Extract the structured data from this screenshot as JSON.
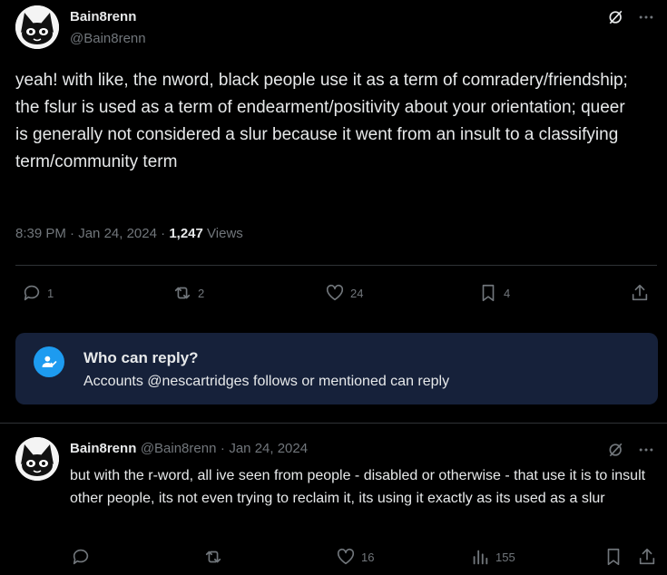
{
  "tweet": {
    "display_name": "Bain8renn",
    "handle": "@Bain8renn",
    "text": "yeah! with like, the nword, black people use it as a term of comradery/friendship; the fslur is used as a term of endearment/positivity about your orientation; queer is generally not considered a slur because it went from an insult to a classifying term/community term",
    "time": "8:39 PM",
    "date": "Jan 24, 2024",
    "views_count": "1,247",
    "views_label": "Views",
    "actions": {
      "replies": "1",
      "reposts": "2",
      "likes": "24",
      "bookmarks": "4"
    }
  },
  "who_can_reply": {
    "title": "Who can reply?",
    "description": "Accounts @nescartridges follows or mentioned can reply"
  },
  "reply": {
    "display_name": "Bain8renn",
    "handle": "@Bain8renn",
    "date": "Jan 24, 2024",
    "text": "but with the r-word, all ive seen from people - disabled or otherwise - that use it is to insult other people, its not even trying to reclaim it, its using it exactly as its used as a slur",
    "actions": {
      "likes": "16",
      "views": "155"
    }
  },
  "colors": {
    "background": "#000000",
    "text": "#e7e9ea",
    "muted": "#71767b",
    "accent": "#1d9bf0",
    "reply_box": "#16213a"
  }
}
